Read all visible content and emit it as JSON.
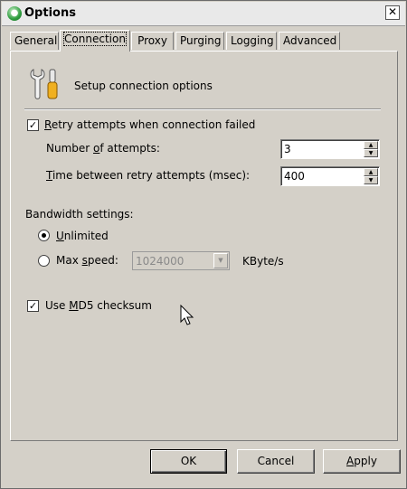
{
  "window": {
    "title": "Options",
    "close_label": "✕"
  },
  "tabs": [
    {
      "label": "General"
    },
    {
      "label": "Connection",
      "active": true
    },
    {
      "label": "Proxy"
    },
    {
      "label": "Purging"
    },
    {
      "label": "Logging"
    },
    {
      "label": "Advanced"
    }
  ],
  "header": {
    "text": "Setup connection options",
    "icon": "tools-icon"
  },
  "retry": {
    "checkbox_label_pre": "",
    "checkbox_label_u": "R",
    "checkbox_label_post": "etry attempts when connection failed",
    "checked": true,
    "attempts_label_pre": "Number ",
    "attempts_label_u": "o",
    "attempts_label_post": "f attempts:",
    "attempts_value": "3",
    "interval_label_pre": "",
    "interval_label_u": "T",
    "interval_label_post": "ime between retry attempts (msec):",
    "interval_value": "400"
  },
  "bandwidth": {
    "group_label": "Bandwidth settings:",
    "unlimited_u": "U",
    "unlimited_post": "nlimited",
    "unlimited_selected": true,
    "max_pre": "Max ",
    "max_u": "s",
    "max_post": "peed:",
    "max_value": "1024000",
    "unit": "KByte/s"
  },
  "md5": {
    "label_pre": "Use ",
    "label_u": "M",
    "label_post": "D5 checksum",
    "checked": true
  },
  "buttons": {
    "ok": "OK",
    "cancel": "Cancel",
    "apply_u": "A",
    "apply_post": "pply"
  },
  "colors": {
    "face": "#d4d0c8",
    "shadow": "#808080",
    "highlight": "#ffffff"
  }
}
